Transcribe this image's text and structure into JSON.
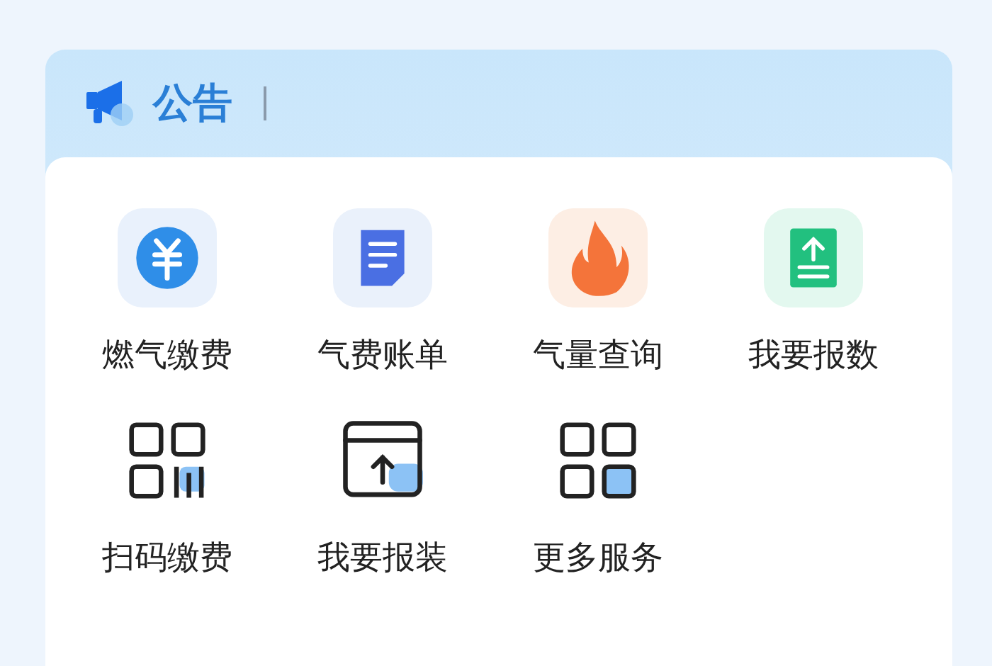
{
  "notice": {
    "title": "公告"
  },
  "services": [
    {
      "kind": "yen",
      "label": "燃气缴费"
    },
    {
      "kind": "doc",
      "label": "气费账单"
    },
    {
      "kind": "flame",
      "label": "气量查询"
    },
    {
      "kind": "upload",
      "label": "我要报数"
    },
    {
      "kind": "scan",
      "label": "扫码缴费"
    },
    {
      "kind": "window-upload",
      "label": "我要报装"
    },
    {
      "kind": "grid",
      "label": "更多服务"
    }
  ]
}
